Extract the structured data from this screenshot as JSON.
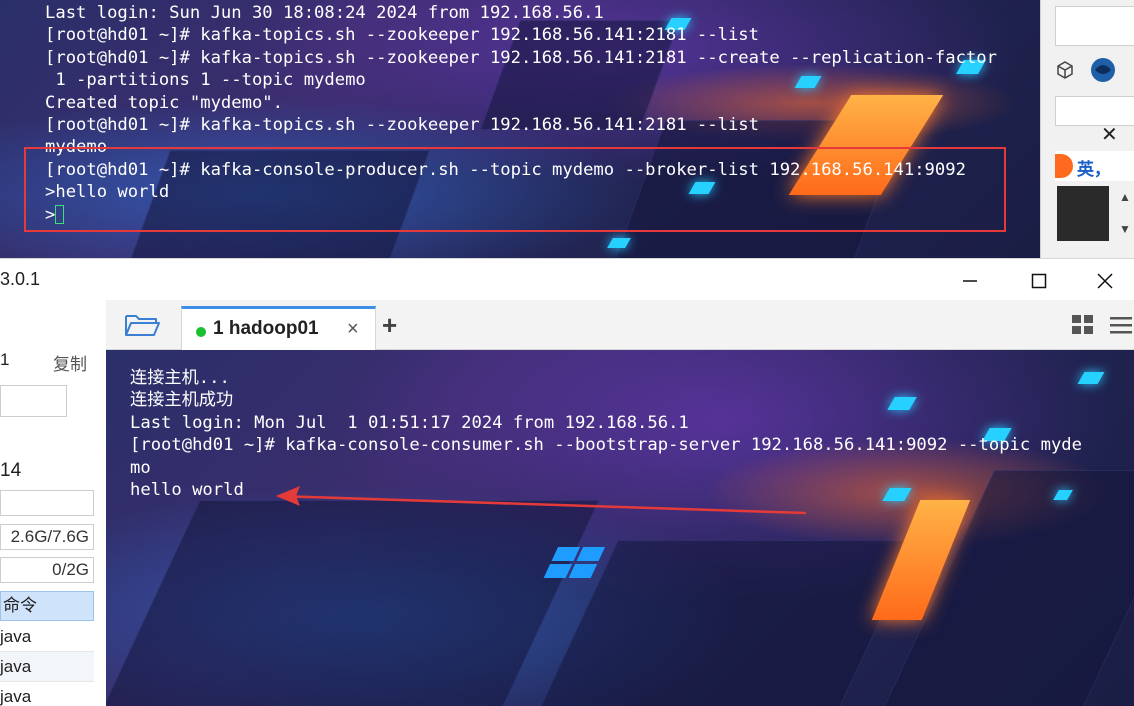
{
  "top_terminal": {
    "lines": [
      "Last login: Sun Jun 30 18:08:24 2024 from 192.168.56.1",
      "[root@hd01 ~]# kafka-topics.sh --zookeeper 192.168.56.141:2181 --list",
      "[root@hd01 ~]# kafka-topics.sh --zookeeper 192.168.56.141:2181 --create --replication-factor",
      " 1 -partitions 1 --topic mydemo",
      "Created topic \"mydemo\".",
      "[root@hd01 ~]# kafka-topics.sh --zookeeper 192.168.56.141:2181 --list",
      "mydemo",
      "[root@hd01 ~]# kafka-console-producer.sh --topic mydemo --broker-list 192.168.56.141:9092",
      ">hello world",
      ">"
    ],
    "highlight_color": "#e5393b",
    "cursor_color": "#38e07a"
  },
  "right_strip": {
    "ime_label": "英",
    "ime_punct": "，",
    "close_glyph": "✕"
  },
  "window": {
    "version_fragment": "3.0.1",
    "minimize_glyph": "—",
    "maximize_glyph": "☐",
    "close_glyph": "✕"
  },
  "sidebar": {
    "session_fragment": "1",
    "copy_label": "复制",
    "number_fragment": "14",
    "memory_value": "2.6G/7.6G",
    "swap_value": "0/2G",
    "commands_header": "命令",
    "command_rows": [
      "java",
      "java",
      "java"
    ]
  },
  "tabs": {
    "items": [
      {
        "label": "1 hadoop01",
        "status_color": "#19c02f",
        "active": true
      }
    ],
    "close_glyph": "×",
    "add_glyph": "+"
  },
  "bottom_terminal": {
    "lines": [
      "连接主机...",
      "连接主机成功",
      "Last login: Mon Jul  1 01:51:17 2024 from 192.168.56.1",
      "[root@hd01 ~]# kafka-console-consumer.sh --bootstrap-server 192.168.56.141:9092 --topic myde",
      "mo",
      "hello world"
    ],
    "arrow_color": "#e53a3a"
  },
  "colors": {
    "accent_blue": "#3d8ee6",
    "terminal_text": "#ffffff"
  }
}
